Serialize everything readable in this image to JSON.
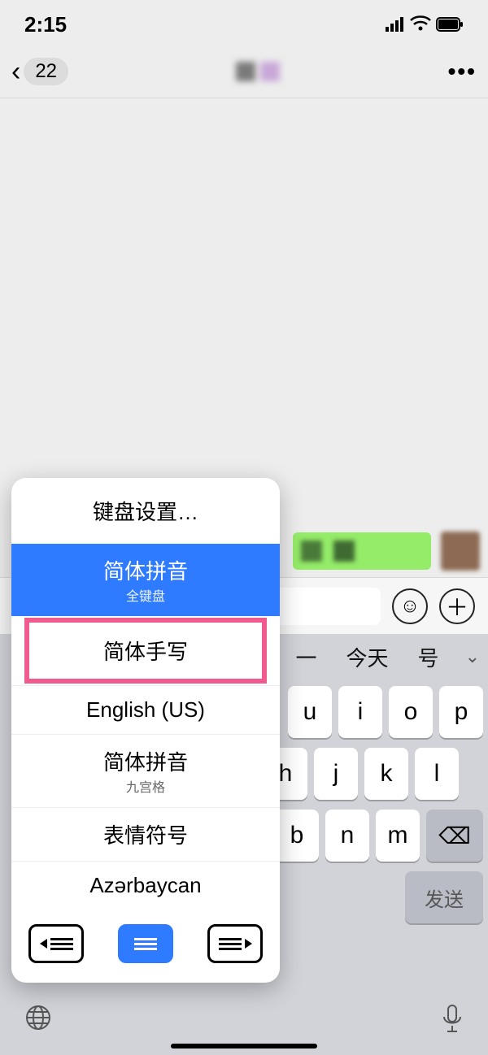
{
  "status": {
    "time": "2:15"
  },
  "nav": {
    "back_count": "22"
  },
  "input_bar": {
    "emoji_glyph": "☺",
    "plus_glyph": "＋"
  },
  "suggestions": [
    "一",
    "今天",
    "号"
  ],
  "keyboard": {
    "row1": [
      "u",
      "i",
      "o",
      "p"
    ],
    "row2": [
      "h",
      "j",
      "k",
      "l"
    ],
    "row3": [
      "b",
      "n",
      "m"
    ],
    "delete_glyph": "⌫",
    "send_label": "发送"
  },
  "bottom": {
    "globe_glyph": "🌐",
    "mic_glyph": "🎤"
  },
  "popup": {
    "header": "键盘设置…",
    "options": [
      {
        "label": "简体拼音",
        "sub": "全键盘",
        "selected": true
      },
      {
        "label": "简体手写",
        "highlight": true
      },
      {
        "label": "English (US)"
      },
      {
        "label": "简体拼音",
        "sub": "九宫格"
      },
      {
        "label": "表情符号"
      },
      {
        "label": "Azərbaycan"
      }
    ]
  }
}
